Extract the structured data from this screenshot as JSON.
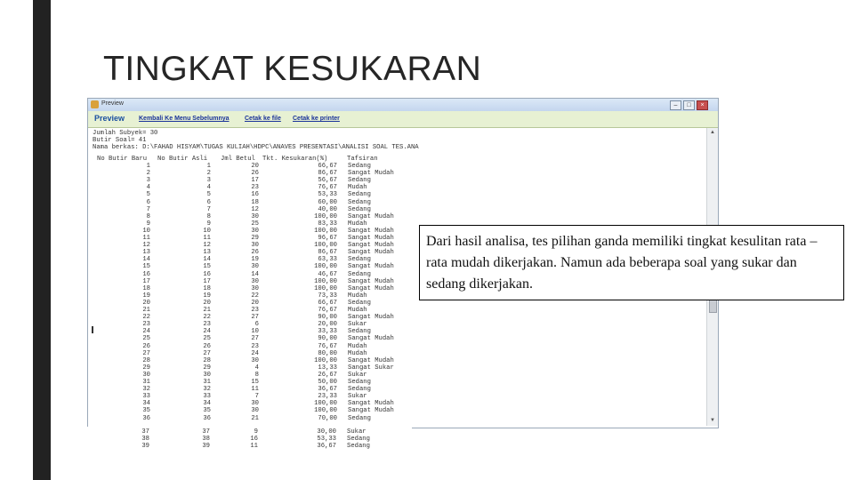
{
  "slide": {
    "title": "TINGKAT KESUKARAN",
    "note": "Dari hasil analisa, tes pilihan ganda memiliki tingkat kesulitan rata – rata mudah dikerjakan. Namun ada beberapa soal yang sukar dan sedang dikerjakan."
  },
  "window": {
    "title": "Preview",
    "menu": {
      "preview": "Preview",
      "back": "Kembali Ke Menu Sebelumnya",
      "print_file": "Cetak ke file",
      "print_printer": "Cetak ke printer"
    },
    "info": [
      "Jumlah Subyek= 30",
      "Butir Soal= 41",
      "Nama berkas: D:\\FAHAD HISYAM\\TUGAS KULIAH\\HDPC\\ANAVES PRESENTASI\\ANALISI SOAL TES.ANA"
    ],
    "table": {
      "headers": [
        "No Butir Baru",
        "No Butir Asli",
        "Jml Betul",
        "Tkt. Kesukaran(%)",
        "Tafsiran"
      ],
      "rows": [
        [
          "1",
          "1",
          "20",
          "66,67",
          "Sedang"
        ],
        [
          "2",
          "2",
          "26",
          "86,67",
          "Sangat Mudah"
        ],
        [
          "3",
          "3",
          "17",
          "56,67",
          "Sedang"
        ],
        [
          "4",
          "4",
          "23",
          "76,67",
          "Mudah"
        ],
        [
          "5",
          "5",
          "16",
          "53,33",
          "Sedang"
        ],
        [
          "6",
          "6",
          "18",
          "60,00",
          "Sedang"
        ],
        [
          "7",
          "7",
          "12",
          "40,00",
          "Sedang"
        ],
        [
          "8",
          "8",
          "30",
          "100,00",
          "Sangat Mudah"
        ],
        [
          "9",
          "9",
          "25",
          "83,33",
          "Mudah"
        ],
        [
          "10",
          "10",
          "30",
          "100,00",
          "Sangat Mudah"
        ],
        [
          "11",
          "11",
          "29",
          "96,67",
          "Sangat Mudah"
        ],
        [
          "12",
          "12",
          "30",
          "100,00",
          "Sangat Mudah"
        ],
        [
          "13",
          "13",
          "26",
          "86,67",
          "Sangat Mudah"
        ],
        [
          "14",
          "14",
          "19",
          "63,33",
          "Sedang"
        ],
        [
          "15",
          "15",
          "30",
          "100,00",
          "Sangat Mudah"
        ],
        [
          "16",
          "16",
          "14",
          "46,67",
          "Sedang"
        ],
        [
          "17",
          "17",
          "30",
          "100,00",
          "Sangat Mudah"
        ],
        [
          "18",
          "18",
          "30",
          "100,00",
          "Sangat Mudah"
        ],
        [
          "19",
          "19",
          "22",
          "73,33",
          "Mudah"
        ],
        [
          "20",
          "20",
          "20",
          "66,67",
          "Sedang"
        ],
        [
          "21",
          "21",
          "23",
          "76,67",
          "Mudah"
        ],
        [
          "22",
          "22",
          "27",
          "90,00",
          "Sangat Mudah"
        ],
        [
          "23",
          "23",
          "6",
          "20,00",
          "Sukar"
        ],
        [
          "24",
          "24",
          "10",
          "33,33",
          "Sedang"
        ],
        [
          "25",
          "25",
          "27",
          "90,00",
          "Sangat Mudah"
        ],
        [
          "26",
          "26",
          "23",
          "76,67",
          "Mudah"
        ],
        [
          "27",
          "27",
          "24",
          "80,00",
          "Mudah"
        ],
        [
          "28",
          "28",
          "30",
          "100,00",
          "Sangat Mudah"
        ],
        [
          "29",
          "29",
          "4",
          "13,33",
          "Sangat Sukar"
        ],
        [
          "30",
          "30",
          "8",
          "26,67",
          "Sukar"
        ],
        [
          "31",
          "31",
          "15",
          "50,00",
          "Sedang"
        ],
        [
          "32",
          "32",
          "11",
          "36,67",
          "Sedang"
        ],
        [
          "33",
          "33",
          "7",
          "23,33",
          "Sukar"
        ],
        [
          "34",
          "34",
          "30",
          "100,00",
          "Sangat Mudah"
        ],
        [
          "35",
          "35",
          "30",
          "100,00",
          "Sangat Mudah"
        ],
        [
          "36",
          "36",
          "21",
          "70,00",
          "Sedang"
        ],
        [
          "37",
          "37",
          "9",
          "30,00",
          "Sukar"
        ],
        [
          "38",
          "38",
          "16",
          "53,33",
          "Sedang"
        ],
        [
          "39",
          "39",
          "11",
          "36,67",
          "Sedang"
        ]
      ]
    }
  }
}
